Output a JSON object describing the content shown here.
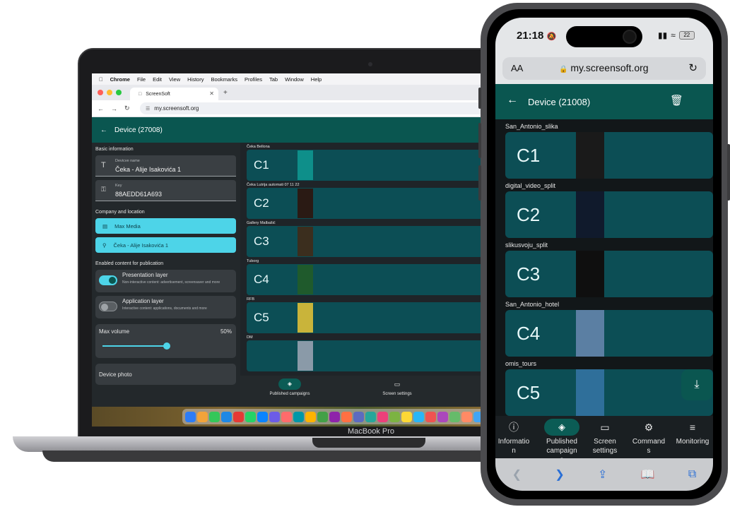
{
  "laptop": {
    "brand": "MacBook Pro",
    "menubar": [
      "Chrome",
      "File",
      "Edit",
      "View",
      "History",
      "Bookmarks",
      "Profiles",
      "Tab",
      "Window",
      "Help"
    ],
    "tab_title": "ScreenSoft",
    "url": "my.screensoft.org",
    "app": {
      "header_title": "Device  (27008)",
      "basic_info_label": "Basic information",
      "device_name_label": "Devicve name",
      "device_name_value": "Čeka - Alije Isakovića 1",
      "key_label": "Key",
      "key_value": "88AEDD61A693",
      "company_label": "Company and location",
      "company_value": "Max Media",
      "location_value": "Čeka - Alije Isakovića 1",
      "enabled_label": "Enabled content for publication",
      "presentation_title": "Presentation layer",
      "presentation_sub": "Non-interactive content: advertisement, screensaver and more",
      "presentation_on": true,
      "application_title": "Application layer",
      "application_sub": "Interactive content: applications, documents and more",
      "application_on": false,
      "volume_label": "Max volume",
      "volume_value": "50%",
      "volume_fraction": 0.5,
      "photo_label": "Device photo",
      "campaigns": [
        {
          "name": "Čeka Bellona",
          "code": "C1",
          "thumb": "#0e8f8a"
        },
        {
          "name": "Čeka Lutrija automati 07 11 22",
          "code": "C2",
          "thumb": "#2a1a14"
        },
        {
          "name": "Gallery Malbašić",
          "code": "C3",
          "thumb": "#3b2e1e"
        },
        {
          "name": "Tuborg",
          "code": "C4",
          "thumb": "#1f5a2c"
        },
        {
          "name": "RFB",
          "code": "C5",
          "thumb": "#c9b43a"
        },
        {
          "name": "DM",
          "code": "",
          "thumb": "#8a9aa8"
        }
      ],
      "nav_published": "Published campaigns",
      "nav_screen": "Screen settings"
    }
  },
  "phone": {
    "time": "21:18",
    "battery": "22",
    "aa": "AA",
    "url": "my.screensoft.org",
    "header_title": "Device  (21008)",
    "campaigns": [
      {
        "name": "San_Antonio_slika",
        "code": "C1",
        "thumb": "#1a1a1a"
      },
      {
        "name": "digital_video_split",
        "code": "C2",
        "thumb": "#101a2c"
      },
      {
        "name": "slikusvoju_split",
        "code": "C3",
        "thumb": "#0f0f0f"
      },
      {
        "name": "San_Antonio_hotel",
        "code": "C4",
        "thumb": "#5b7fa3"
      },
      {
        "name": "omis_tours",
        "code": "C5",
        "thumb": "#2f6f9a"
      }
    ],
    "nav": {
      "info": "Informatio\nn",
      "published": "Published\ncampaign\ns",
      "screen": "Screen\nsettings",
      "commands": "Command\ns",
      "monitoring": "Monitoring"
    }
  },
  "colors": {
    "accent_teal": "#0a5650",
    "card_teal": "#0c4e55",
    "cyan": "#4dd4e8"
  }
}
